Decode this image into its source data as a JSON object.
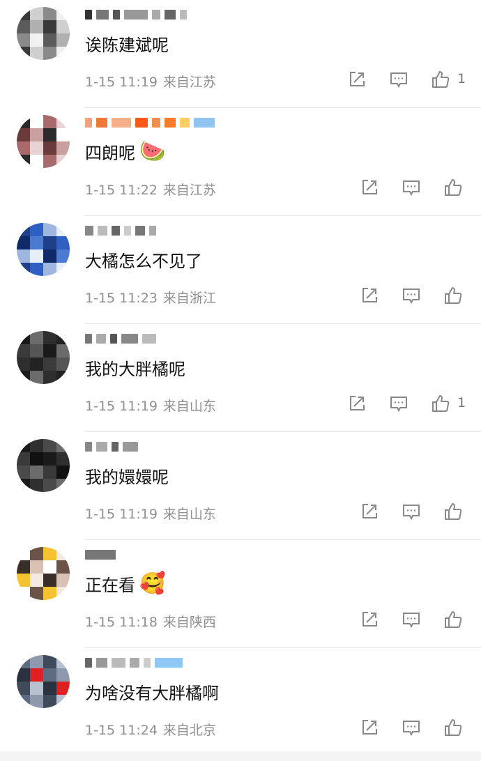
{
  "comments": [
    {
      "text": "诶陈建斌呢",
      "time": "1-15 11:19",
      "location": "来自江苏",
      "likes": "1"
    },
    {
      "text": "四朗呢",
      "time": "1-15 11:22",
      "location": "来自江苏",
      "likes": "",
      "emoji": "watermelon-emoji"
    },
    {
      "text": "大橘怎么不见了",
      "time": "1-15 11:23",
      "location": "来自浙江",
      "likes": ""
    },
    {
      "text": "我的大胖橘呢",
      "time": "1-15 11:19",
      "location": "来自山东",
      "likes": "1"
    },
    {
      "text": "我的嬛嬛呢",
      "time": "1-15 11:19",
      "location": "来自山东",
      "likes": ""
    },
    {
      "text": "正在看",
      "time": "1-15 11:18",
      "location": "来自陕西",
      "likes": "",
      "emoji": "smiling-face-hearts-emoji"
    },
    {
      "text": "为啥没有大胖橘啊",
      "time": "1-15 11:24",
      "location": "来自北京",
      "likes": ""
    }
  ],
  "icons": {
    "share": "share-icon",
    "reply": "comment-icon",
    "like": "thumbs-up-icon"
  },
  "colors": {
    "text": "#111111",
    "meta": "#8f8f8f",
    "icon": "#888888",
    "divider": "#e6e6e6"
  }
}
